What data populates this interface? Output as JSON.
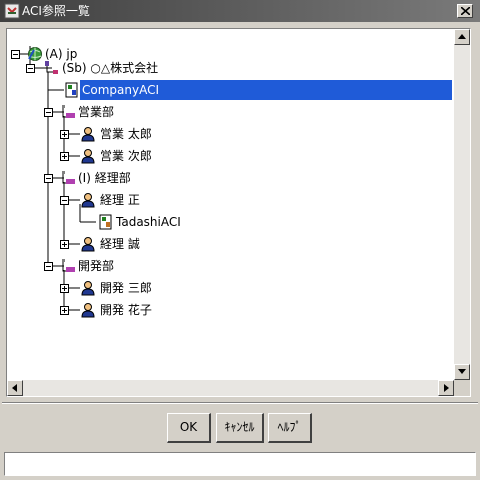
{
  "window": {
    "title": "ACI参照一覧"
  },
  "tree": {
    "nodes": [
      {
        "label": "(A) jp",
        "icon": "globe-icon",
        "expanded": true
      },
      {
        "label": "(Sb) ○△株式会社",
        "icon": "org-node-icon",
        "expanded": true
      },
      {
        "label": "CompanyACI",
        "icon": "aci-icon",
        "selected": true
      },
      {
        "label": "営業部",
        "icon": "department-icon",
        "expanded": true
      },
      {
        "label": "営業 太郎",
        "icon": "user-icon",
        "expanded": false
      },
      {
        "label": "営業 次郎",
        "icon": "user-icon",
        "expanded": false
      },
      {
        "label": "(I) 経理部",
        "icon": "department-icon",
        "expanded": true
      },
      {
        "label": "経理 正",
        "icon": "user-icon",
        "expanded": true
      },
      {
        "label": "TadashiACI",
        "icon": "aci-icon"
      },
      {
        "label": "経理 誠",
        "icon": "user-icon",
        "expanded": false
      },
      {
        "label": "開発部",
        "icon": "department-icon",
        "expanded": true
      },
      {
        "label": "開発 三郎",
        "icon": "user-icon",
        "expanded": false
      },
      {
        "label": "開発 花子",
        "icon": "user-icon",
        "expanded": false
      }
    ]
  },
  "buttons": {
    "ok": "OK",
    "cancel": "ｷｬﾝｾﾙ",
    "help": "ﾍﾙﾌﾟ"
  },
  "status": {
    "value": ""
  }
}
